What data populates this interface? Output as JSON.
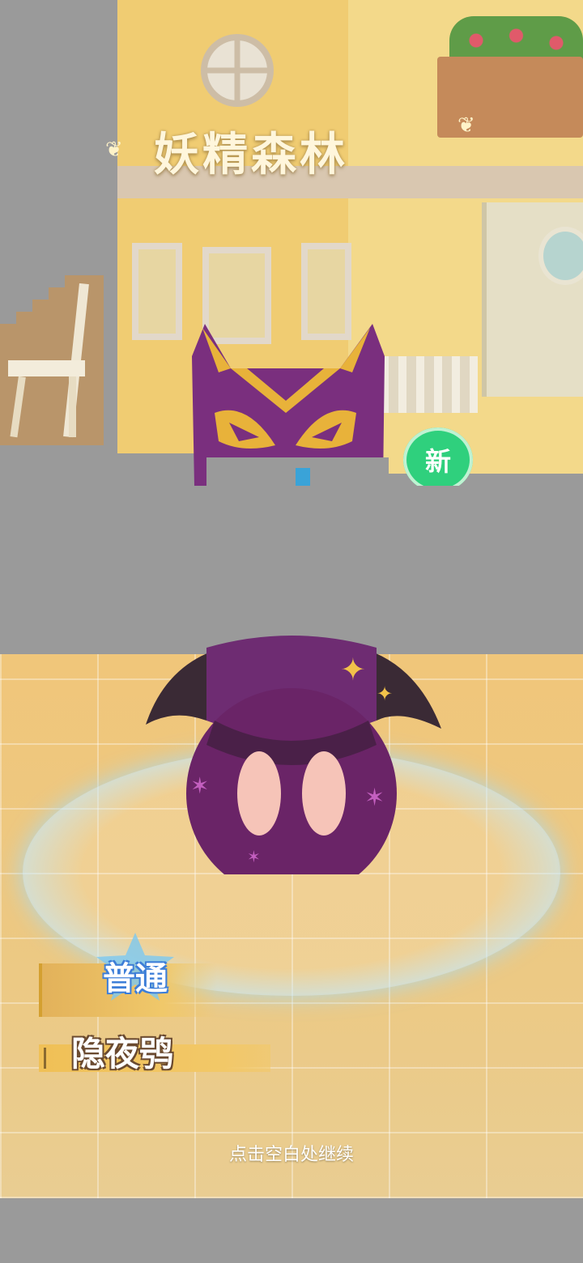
{
  "header": {
    "area_title": "妖精森林",
    "new_badge": "新"
  },
  "pet": {
    "rarity": "普通",
    "name": "隐夜鸮"
  },
  "footer": {
    "hint": "点击空白处继续"
  },
  "colors": {
    "new_badge": "#2fd07d",
    "rarity_outline": "#3e7fd8",
    "pet_purple": "#7a2f7e",
    "accent_gold": "#f0c056"
  }
}
